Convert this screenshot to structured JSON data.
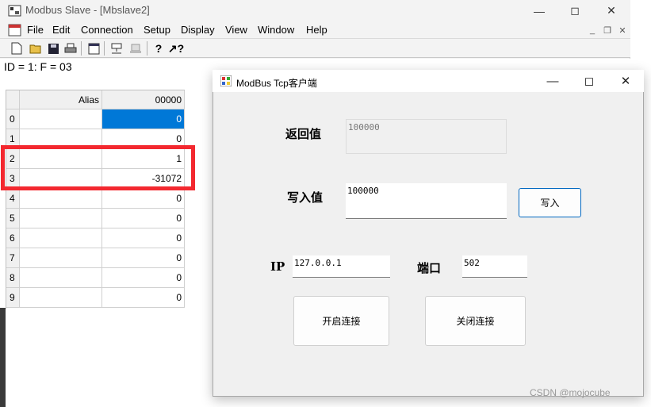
{
  "app": {
    "title": "Modbus Slave - [Mbslave2]",
    "menus": [
      "File",
      "Edit",
      "Connection",
      "Setup",
      "Display",
      "View",
      "Window",
      "Help"
    ]
  },
  "child": {
    "status_line": "ID = 1: F = 03",
    "grid": {
      "headers": [
        "Alias",
        "00000"
      ],
      "rows": [
        {
          "idx": "0",
          "alias": "",
          "value": "0"
        },
        {
          "idx": "1",
          "alias": "",
          "value": "0"
        },
        {
          "idx": "2",
          "alias": "",
          "value": "1"
        },
        {
          "idx": "3",
          "alias": "",
          "value": "-31072"
        },
        {
          "idx": "4",
          "alias": "",
          "value": "0"
        },
        {
          "idx": "5",
          "alias": "",
          "value": "0"
        },
        {
          "idx": "6",
          "alias": "",
          "value": "0"
        },
        {
          "idx": "7",
          "alias": "",
          "value": "0"
        },
        {
          "idx": "8",
          "alias": "",
          "value": "0"
        },
        {
          "idx": "9",
          "alias": "",
          "value": "0"
        }
      ]
    }
  },
  "dialog": {
    "title": "ModBus Tcp客户端",
    "return_label": "返回值",
    "return_value": "100000",
    "write_label": "写入值",
    "write_value": "100000",
    "write_button": "写入",
    "ip_label": "IP",
    "ip_value": "127.0.0.1",
    "port_label": "端口",
    "port_value": "502",
    "open_button": "开启连接",
    "close_button": "关闭连接"
  },
  "watermark": "CSDN @mojocube",
  "colors": {
    "selection": "#0078d7",
    "highlight": "#f3282f"
  }
}
